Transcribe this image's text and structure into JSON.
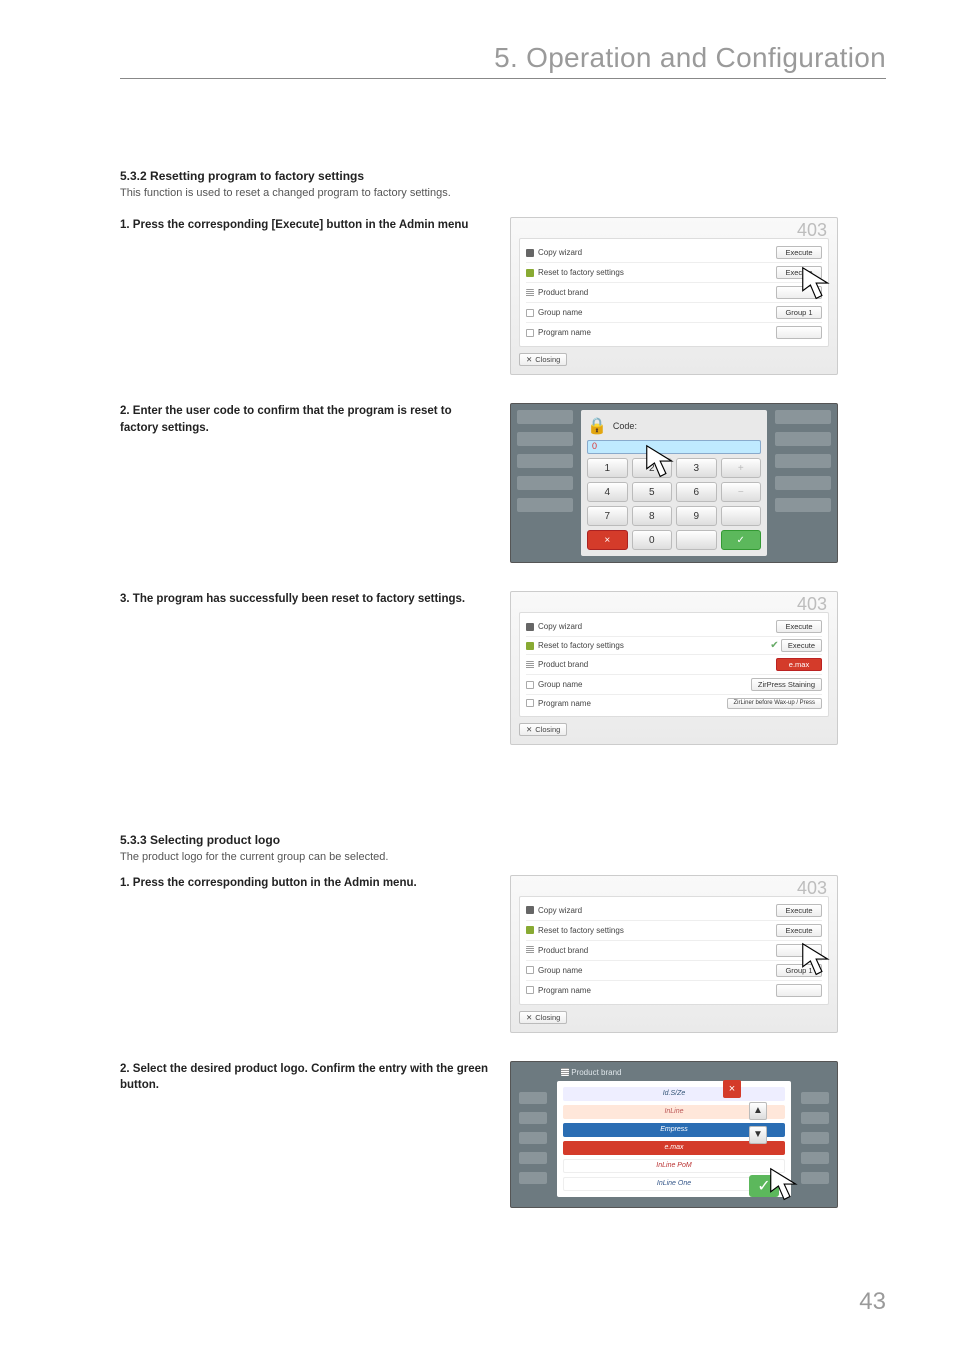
{
  "header": {
    "chapter_title": "5. Operation and Configuration"
  },
  "page_number": "43",
  "sections": {
    "s532": {
      "heading": "5.3.2  Resetting program to factory settings",
      "desc": "This function is used to reset a changed program to factory settings.",
      "steps": {
        "s1": {
          "num": "1.",
          "text": "Press the corresponding [Execute] button in the Admin menu"
        },
        "s2": {
          "num": "2.",
          "text": "Enter the user code to confirm that the program is reset to factory settings."
        },
        "s3": {
          "num": "3.",
          "text": "The program has successfully been reset to factory settings."
        }
      }
    },
    "s533": {
      "heading": "5.3.3  Selecting product logo",
      "desc": "The product logo for the current group can be selected.",
      "steps": {
        "s1": {
          "num": "1.",
          "text": "Press the corresponding button in the Admin menu."
        },
        "s2": {
          "num": "2.",
          "text": "Select the desired product logo. Confirm the entry with the green button."
        }
      }
    }
  },
  "mock": {
    "topnum": "403",
    "rows": {
      "copy": "Copy wizard",
      "reset": "Reset to factory settings",
      "brand": "Product brand",
      "group": "Group name",
      "program": "Program name"
    },
    "buttons": {
      "execute": "Execute",
      "group1": "Group 1",
      "close": "Closing",
      "zirpress": "ZirPress Staining",
      "zirliner": "ZirLiner before Wax-up / Press",
      "emax": "e.max"
    },
    "keypad": {
      "code_label": "Code:",
      "zero": "0",
      "keys": [
        "1",
        "2",
        "3",
        "+",
        "4",
        "5",
        "6",
        "−",
        "7",
        "8",
        "9",
        " ",
        "×",
        "0",
        " ",
        "✓"
      ]
    },
    "logos": {
      "title": "Product brand",
      "b1": "Id.S/Ze",
      "b2": "InLine",
      "b3": "Empress",
      "b4": "e.max",
      "b5": "InLine PoM",
      "b6": "InLine One"
    }
  }
}
